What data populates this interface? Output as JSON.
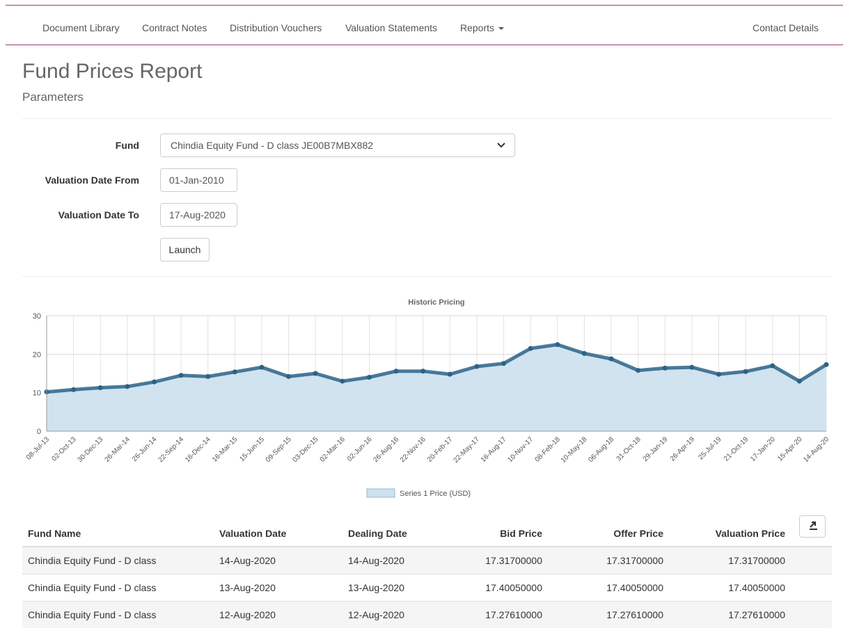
{
  "nav": {
    "items": [
      "Document Library",
      "Contract Notes",
      "Distribution Vouchers",
      "Valuation Statements",
      "Reports"
    ],
    "contact": "Contact Details"
  },
  "page": {
    "title": "Fund Prices Report",
    "subtitle": "Parameters"
  },
  "form": {
    "fund_label": "Fund",
    "fund_value": "Chindia Equity Fund - D class JE00B7MBX882",
    "date_from_label": "Valuation Date From",
    "date_from_value": "01-Jan-2010",
    "date_to_label": "Valuation Date To",
    "date_to_value": "17-Aug-2020",
    "launch_label": "Launch"
  },
  "colors": {
    "nav_border": "#9b3a6e",
    "area_fill": "#cde1ee",
    "line": "#2b6388"
  },
  "chart_data": {
    "type": "area",
    "title": "Historic Pricing",
    "legend": "Series 1 Price (USD)",
    "legend_position": "bottom",
    "grid": true,
    "ylim": [
      0,
      30
    ],
    "yticks": [
      0,
      10,
      20,
      30
    ],
    "x": [
      "08-Jul-13",
      "02-Oct-13",
      "30-Dec-13",
      "26-Mar-14",
      "26-Jun-14",
      "22-Sep-14",
      "16-Dec-14",
      "16-Mar-15",
      "15-Jun-15",
      "09-Sep-15",
      "03-Dec-15",
      "02-Mar-16",
      "02-Jun-16",
      "26-Aug-16",
      "22-Nov-16",
      "20-Feb-17",
      "22-May-17",
      "16-Aug-17",
      "10-Nov-17",
      "08-Feb-18",
      "10-May-18",
      "06-Aug-18",
      "31-Oct-18",
      "29-Jan-19",
      "26-Apr-19",
      "25-Jul-19",
      "21-Oct-19",
      "17-Jan-20",
      "15-Apr-20",
      "14-Aug-20"
    ],
    "values": [
      10.2,
      10.8,
      11.3,
      11.6,
      12.8,
      14.5,
      14.2,
      15.4,
      16.6,
      14.2,
      15.0,
      13.0,
      14.0,
      15.6,
      15.6,
      14.8,
      16.8,
      17.6,
      21.5,
      22.5,
      20.2,
      18.8,
      15.8,
      16.4,
      16.6,
      14.8,
      15.5,
      17.0,
      13.0,
      17.3
    ]
  },
  "table": {
    "headers": [
      "Fund Name",
      "Valuation Date",
      "Dealing Date",
      "Bid Price",
      "Offer Price",
      "Valuation Price"
    ],
    "rows": [
      [
        "Chindia Equity Fund - D class",
        "14-Aug-2020",
        "14-Aug-2020",
        "17.31700000",
        "17.31700000",
        "17.31700000"
      ],
      [
        "Chindia Equity Fund - D class",
        "13-Aug-2020",
        "13-Aug-2020",
        "17.40050000",
        "17.40050000",
        "17.40050000"
      ],
      [
        "Chindia Equity Fund - D class",
        "12-Aug-2020",
        "12-Aug-2020",
        "17.27610000",
        "17.27610000",
        "17.27610000"
      ]
    ]
  }
}
